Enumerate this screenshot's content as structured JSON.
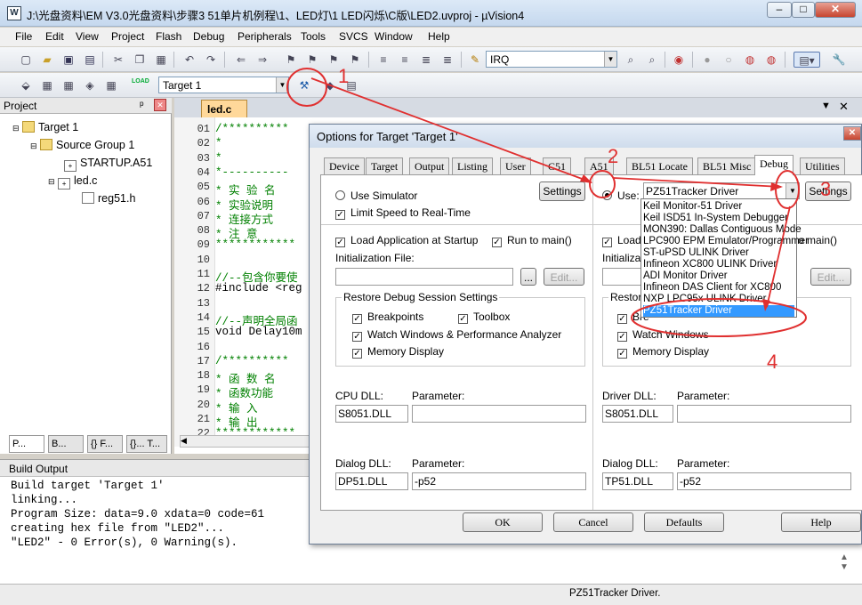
{
  "window": {
    "title": "J:\\光盘资料\\EM V3.0光盘资料\\步骤3 51单片机例程\\1、LED灯\\1 LED闪烁\\C版\\LED2.uvproj - µVision4",
    "app_icon": "W",
    "minimize": "–",
    "maximize": "□",
    "close": "✕"
  },
  "menu": [
    "File",
    "Edit",
    "View",
    "Project",
    "Flash",
    "Debug",
    "Peripherals",
    "Tools",
    "SVCS",
    "Window",
    "Help"
  ],
  "toolbar": {
    "search_combo_value": "IRQ",
    "target_combo_value": "Target 1",
    "load_label": "LOAD"
  },
  "project_pane": {
    "header": "Project",
    "pin": "ᵖ",
    "close": "✕",
    "tree": [
      {
        "label": "Target 1"
      },
      {
        "label": "Source Group 1"
      },
      {
        "label": "STARTUP.A51"
      },
      {
        "label": "led.c"
      },
      {
        "label": "reg51.h"
      }
    ],
    "tabs": [
      "P...",
      "B...",
      "{} F...",
      "{}... T..."
    ]
  },
  "editor": {
    "tab": "led.c",
    "line_numbers": [
      "01",
      "02",
      "03",
      "04",
      "05",
      "06",
      "07",
      "08",
      "09",
      "10",
      "11",
      "12",
      "13",
      "14",
      "15",
      "16",
      "17",
      "18",
      "19",
      "20",
      "21",
      "22"
    ],
    "lines": [
      "/**********",
      "*",
      "*",
      "*----------",
      "* 实 验 名",
      "* 实验说明",
      "* 连接方式",
      "* 注    意",
      "************",
      "",
      "//--包含你要使",
      "#include <reg",
      "",
      "//--声明全局函",
      "void Delay10m",
      "",
      "/**********",
      "* 函 数 名",
      "* 函数功能",
      "* 输    入",
      "* 输    出",
      "************"
    ]
  },
  "build": {
    "header": "Build Output",
    "lines": [
      "Build target 'Target 1'",
      "linking...",
      "Program Size: data=9.0 xdata=0 code=61",
      "creating hex file from \"LED2\"...",
      "\"LED2\" - 0 Error(s), 0 Warning(s)."
    ]
  },
  "status": "PZ51Tracker Driver.",
  "dialog": {
    "title": "Options for Target 'Target 1'",
    "close": "✕",
    "tabs": [
      "Device",
      "Target",
      "Output",
      "Listing",
      "User",
      "C51",
      "A51",
      "BL51 Locate",
      "BL51 Misc",
      "Debug",
      "Utilities"
    ],
    "active_tab": "Debug",
    "left": {
      "use_simulator": "Use Simulator",
      "settings": "Settings",
      "limit_speed": "Limit Speed to Real-Time",
      "load_app": "Load Application at Startup",
      "run_main": "Run to main()",
      "init_file": "Initialization File:",
      "browse": "...",
      "edit": "Edit...",
      "restore_group": "Restore Debug Session Settings",
      "breakpoints": "Breakpoints",
      "toolbox": "Toolbox",
      "watch_windows": "Watch Windows & Performance Analyzer",
      "memory_display": "Memory Display",
      "cpu_dll_label": "CPU DLL:",
      "cpu_dll_value": "S8051.DLL",
      "parameter_label": "Parameter:",
      "cpu_param_value": "",
      "dialog_dll_label": "Dialog DLL:",
      "dialog_dll_value": "DP51.DLL",
      "dialog_param_value": "-p52"
    },
    "right": {
      "use": "Use:",
      "driver_value": "PZ51Tracker Driver",
      "settings": "Settings",
      "load": "Load",
      "run_main_partial": "o main()",
      "init_partial": "Initializati",
      "edit": "Edit...",
      "restore_partial": "Restore",
      "breakpoints_partial": "Bre",
      "watch_windows": "Watch Windows",
      "memory_display": "Memory Display",
      "driver_dll_label": "Driver DLL:",
      "driver_dll_value": "S8051.DLL",
      "parameter_label": "Parameter:",
      "driver_param_value": "",
      "dialog_dll_label": "Dialog DLL:",
      "dialog_dll_value": "TP51.DLL",
      "dialog_param_value": "-p52"
    },
    "driver_options": [
      "Keil Monitor-51 Driver",
      "Keil ISD51 In-System Debugger",
      "MON390: Dallas Contiguous Mode",
      "LPC900 EPM Emulator/Programmer",
      "ST-uPSD ULINK Driver",
      "Infineon XC800 ULINK Driver",
      "ADI Monitor Driver",
      "Infineon DAS Client for XC800",
      "NXP LPC95x ULINK Driver",
      "PZ51Tracker Driver"
    ],
    "selected_driver_index": 9,
    "buttons": {
      "ok": "OK",
      "cancel": "Cancel",
      "defaults": "Defaults",
      "help": "Help"
    }
  },
  "annotations": [
    "1",
    "2",
    "3",
    "4"
  ],
  "colors": {
    "annotation": "#e03030",
    "selection": "#3399ff",
    "editor_tab": "#ffd89a",
    "comment": "#008000"
  }
}
